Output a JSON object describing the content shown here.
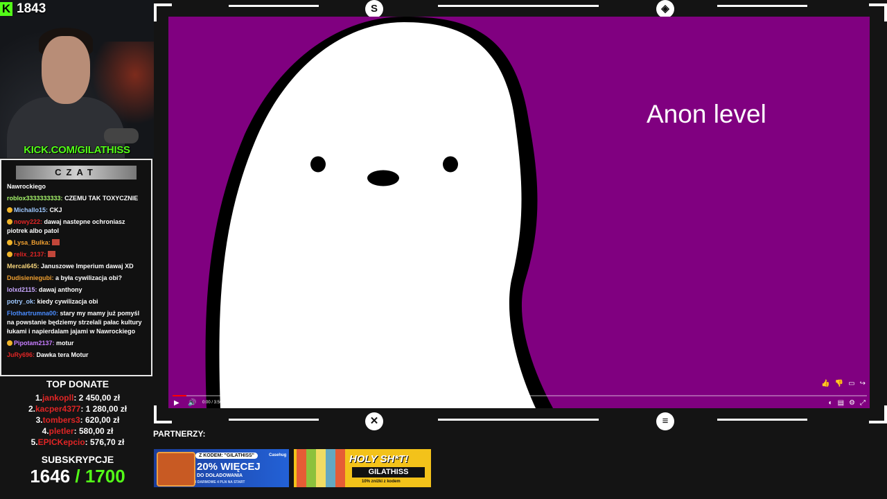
{
  "stream": {
    "viewer_count": "1843",
    "kick_url": "KICK.COM/GILATHISS"
  },
  "chat": {
    "title": "CZAT",
    "messages": [
      {
        "user": "",
        "user_color": "#ffffff",
        "text": "Nawrockiego",
        "badge": false,
        "emote": false
      },
      {
        "user": "roblox3333333333:",
        "user_color": "#a6f56b",
        "text": " CZEMU TAK TOXYCZNIE",
        "badge": false,
        "emote": false
      },
      {
        "user": "Michallo15:",
        "user_color": "#9ec8ff",
        "text": " CKJ",
        "badge": true,
        "emote": false
      },
      {
        "user": "nowy222:",
        "user_color": "#e02525",
        "text": " dawaj nastepne ochroniasz piotrek albo patol",
        "badge": true,
        "emote": false
      },
      {
        "user": "Lysa_Bulka:",
        "user_color": "#f0a030",
        "text": "",
        "badge": true,
        "emote": true
      },
      {
        "user": "relix_2137:",
        "user_color": "#e02525",
        "text": "",
        "badge": true,
        "emote": true
      },
      {
        "user": "Mercal645:",
        "user_color": "#f3d27a",
        "text": " Januszowe Imperium dawaj XD",
        "badge": false,
        "emote": false
      },
      {
        "user": "Dudisieniegubi:",
        "user_color": "#f0a030",
        "text": " a była cywilizacja obi?",
        "badge": false,
        "emote": false
      },
      {
        "user": "lolxd2115:",
        "user_color": "#c9a8ff",
        "text": " dawaj anthony",
        "badge": false,
        "emote": false
      },
      {
        "user": "potry_ok:",
        "user_color": "#9ec8ff",
        "text": " kiedy cywilizacja obi",
        "badge": false,
        "emote": false
      },
      {
        "user": "Flothartrumna00:",
        "user_color": "#4a8cff",
        "text": " stary my mamy już pomyśl na powstanie będziemy strzelali pałac kultury łukami i napierdalam jajami w Nawrockiego",
        "badge": false,
        "emote": false
      },
      {
        "user": "Pipotam2137:",
        "user_color": "#c77dff",
        "text": " motur",
        "badge": true,
        "emote": false
      },
      {
        "user": "JuRy696:",
        "user_color": "#e02525",
        "text": " Dawka tera Motur",
        "badge": false,
        "emote": false
      }
    ]
  },
  "top_donate": {
    "title": "TOP DONATE",
    "entries": [
      {
        "rank": "1.",
        "name": "jankopll",
        "amount": ": 2 450,00 zł"
      },
      {
        "rank": "2.",
        "name": "kacper4377",
        "amount": ": 1 280,00 zł"
      },
      {
        "rank": "3.",
        "name": "tombers3",
        "amount": ": 620,00 zł"
      },
      {
        "rank": "4.",
        "name": "pletler",
        "amount": ": 580,00 zł"
      },
      {
        "rank": "5.",
        "name": "EPICKepcio",
        "amount": ": 576,70 zł"
      }
    ]
  },
  "subscriptions": {
    "title": "SUBSKRYPCJE",
    "current": "1646",
    "goal": " / 1700"
  },
  "video": {
    "slide_text": "Anon level",
    "time": "0:00 / 3:50",
    "progress": 0.002
  },
  "partners": {
    "label": "PARTNERZY:",
    "banner1": {
      "tag": "Z KODEM: \"GILATHISS\"",
      "headline": "20% WIĘCEJ",
      "line2": "DO DOŁADOWANIA",
      "line3": "I DARMOWE 4 PLN NA START",
      "brand": "Casehug"
    },
    "banner2": {
      "headline": "HOLY SH*T!",
      "code": "GILATHISS",
      "discount": "10% zniżki z kodem"
    }
  },
  "colors": {
    "kick_green": "#53fc18",
    "video_bg": "#800080",
    "donor_red": "#e02525"
  }
}
